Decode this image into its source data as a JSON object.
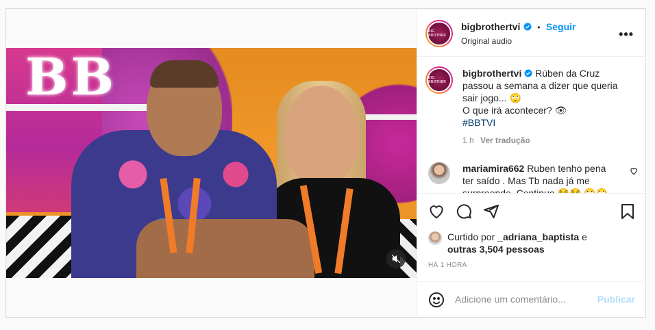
{
  "post": {
    "media": {
      "sign_text": "BB",
      "mute_icon": "muted-speaker-icon"
    },
    "header": {
      "username": "bigbrothertvi",
      "follow_label": "Seguir",
      "separator": "•",
      "audio": "Original audio",
      "avatar_text": "BIG BROTHER",
      "more_icon": "more-options-icon"
    },
    "caption": {
      "username": "bigbrothertvi",
      "line1": "Rúben da Cruz",
      "line2": "passou a semana a dizer que queria",
      "line3": "sair jogo... 🙄",
      "line4": "O que irá acontecer? 👁",
      "hashtag": "#BBTVI",
      "time": "1 h",
      "translate": "Ver tradução"
    },
    "comments": [
      {
        "username": "mariamira662",
        "text_line1": "Ruben tenho pena",
        "text_line2": "ter saído . Mas Tb nada já me",
        "text_line3": "surpreende. Continuo 😂😂 🙄🙄"
      }
    ],
    "actions": {
      "like_icon": "heart-icon",
      "comment_icon": "comment-icon",
      "share_icon": "share-icon",
      "save_icon": "bookmark-icon"
    },
    "likes": {
      "prefix": "Curtido por",
      "user": "_adriana_baptista",
      "joiner": "e",
      "others": "outras 3,504 pessoas"
    },
    "time_ago": "HÁ 1 HORA",
    "add_comment": {
      "placeholder": "Adicione um comentário...",
      "publish_label": "Publicar",
      "emoji_icon": "emoji-icon"
    }
  }
}
